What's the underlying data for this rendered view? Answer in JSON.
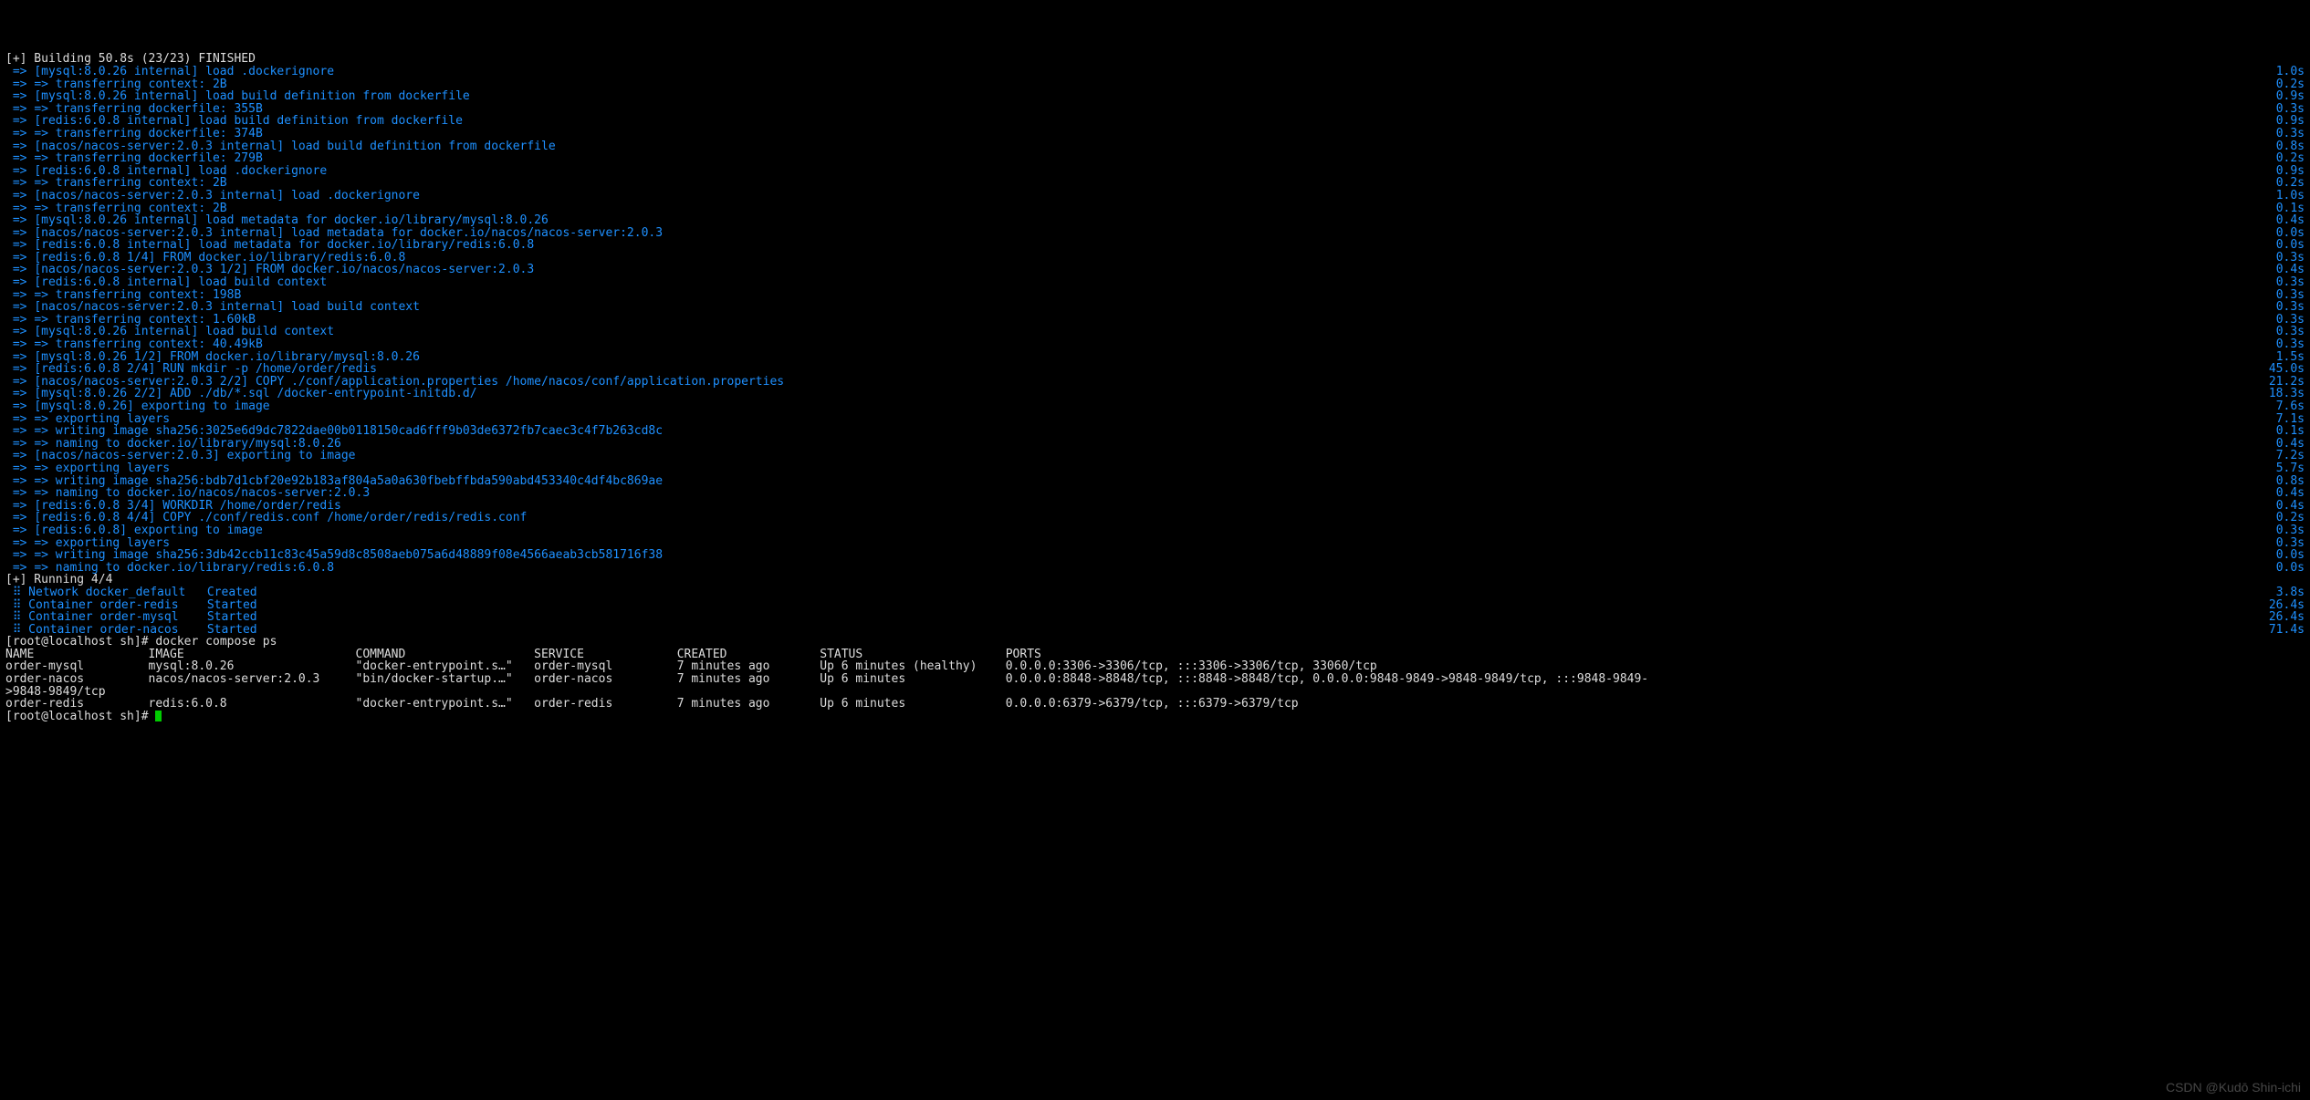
{
  "header": "[+] Building 50.8s (23/23) FINISHED",
  "lines": [
    {
      "text": "[mysql:8.0.26 internal] load .dockerignore",
      "time": "1.0s"
    },
    {
      "text": "=> transferring context: 2B",
      "time": "0.2s"
    },
    {
      "text": "[mysql:8.0.26 internal] load build definition from dockerfile",
      "time": "0.9s"
    },
    {
      "text": "=> transferring dockerfile: 355B",
      "time": "0.3s"
    },
    {
      "text": "[redis:6.0.8 internal] load build definition from dockerfile",
      "time": "0.9s"
    },
    {
      "text": "=> transferring dockerfile: 374B",
      "time": "0.3s"
    },
    {
      "text": "[nacos/nacos-server:2.0.3 internal] load build definition from dockerfile",
      "time": "0.8s"
    },
    {
      "text": "=> transferring dockerfile: 279B",
      "time": "0.2s"
    },
    {
      "text": "[redis:6.0.8 internal] load .dockerignore",
      "time": "0.9s"
    },
    {
      "text": "=> transferring context: 2B",
      "time": "0.2s"
    },
    {
      "text": "[nacos/nacos-server:2.0.3 internal] load .dockerignore",
      "time": "1.0s"
    },
    {
      "text": "=> transferring context: 2B",
      "time": "0.1s"
    },
    {
      "text": "[mysql:8.0.26 internal] load metadata for docker.io/library/mysql:8.0.26",
      "time": "0.4s"
    },
    {
      "text": "[nacos/nacos-server:2.0.3 internal] load metadata for docker.io/nacos/nacos-server:2.0.3",
      "time": "0.0s"
    },
    {
      "text": "[redis:6.0.8 internal] load metadata for docker.io/library/redis:6.0.8",
      "time": "0.0s"
    },
    {
      "text": "[redis:6.0.8 1/4] FROM docker.io/library/redis:6.0.8",
      "time": "0.3s"
    },
    {
      "text": "[nacos/nacos-server:2.0.3 1/2] FROM docker.io/nacos/nacos-server:2.0.3",
      "time": "0.4s"
    },
    {
      "text": "[redis:6.0.8 internal] load build context",
      "time": "0.3s"
    },
    {
      "text": "=> transferring context: 198B",
      "time": "0.3s"
    },
    {
      "text": "[nacos/nacos-server:2.0.3 internal] load build context",
      "time": "0.3s"
    },
    {
      "text": "=> transferring context: 1.60kB",
      "time": "0.3s"
    },
    {
      "text": "[mysql:8.0.26 internal] load build context",
      "time": "0.3s"
    },
    {
      "text": "=> transferring context: 40.49kB",
      "time": "0.3s"
    },
    {
      "text": "[mysql:8.0.26 1/2] FROM docker.io/library/mysql:8.0.26",
      "time": "1.5s"
    },
    {
      "text": "[redis:6.0.8 2/4] RUN mkdir -p /home/order/redis",
      "time": "45.0s"
    },
    {
      "text": "[nacos/nacos-server:2.0.3 2/2] COPY ./conf/application.properties /home/nacos/conf/application.properties",
      "time": "21.2s"
    },
    {
      "text": "[mysql:8.0.26 2/2] ADD ./db/*.sql /docker-entrypoint-initdb.d/",
      "time": "18.3s"
    },
    {
      "text": "[mysql:8.0.26] exporting to image",
      "time": "7.6s"
    },
    {
      "text": "=> exporting layers",
      "time": "7.1s"
    },
    {
      "text": "=> writing image sha256:3025e6d9dc7822dae00b0118150cad6fff9b03de6372fb7caec3c4f7b263cd8c",
      "time": "0.1s"
    },
    {
      "text": "=> naming to docker.io/library/mysql:8.0.26",
      "time": "0.4s"
    },
    {
      "text": "[nacos/nacos-server:2.0.3] exporting to image",
      "time": "7.2s"
    },
    {
      "text": "=> exporting layers",
      "time": "5.7s"
    },
    {
      "text": "=> writing image sha256:bdb7d1cbf20e92b183af804a5a0a630fbebffbda590abd453340c4df4bc869ae",
      "time": "0.8s"
    },
    {
      "text": "=> naming to docker.io/nacos/nacos-server:2.0.3",
      "time": "0.4s"
    },
    {
      "text": "[redis:6.0.8 3/4] WORKDIR /home/order/redis",
      "time": "0.4s"
    },
    {
      "text": "[redis:6.0.8 4/4] COPY ./conf/redis.conf /home/order/redis/redis.conf",
      "time": "0.2s"
    },
    {
      "text": "[redis:6.0.8] exporting to image",
      "time": "0.3s"
    },
    {
      "text": "=> exporting layers",
      "time": "0.3s"
    },
    {
      "text": "=> writing image sha256:3db42ccb11c83c45a59d8c8508aeb075a6d48889f08e4566aeab3cb581716f38",
      "time": "0.0s"
    },
    {
      "text": "=> naming to docker.io/library/redis:6.0.8",
      "time": "0.0s"
    }
  ],
  "running_header": "[+] Running 4/4",
  "running": [
    {
      "label": "Network docker_default   Created",
      "time": "3.8s"
    },
    {
      "label": "Container order-redis    Started",
      "time": "26.4s"
    },
    {
      "label": "Container order-mysql    Started",
      "time": "26.4s"
    },
    {
      "label": "Container order-nacos    Started",
      "time": "71.4s"
    }
  ],
  "prompt1": "[root@localhost sh]# ",
  "cmd1": "docker compose ps",
  "ps": {
    "header": "NAME                IMAGE                        COMMAND                  SERVICE             CREATED             STATUS                    PORTS",
    "rows": [
      "order-mysql         mysql:8.0.26                 \"docker-entrypoint.s…\"   order-mysql         7 minutes ago       Up 6 minutes (healthy)    0.0.0.0:3306->3306/tcp, :::3306->3306/tcp, 33060/tcp",
      "order-nacos         nacos/nacos-server:2.0.3     \"bin/docker-startup.…\"   order-nacos         7 minutes ago       Up 6 minutes              0.0.0.0:8848->8848/tcp, :::8848->8848/tcp, 0.0.0.0:9848-9849->9848-9849/tcp, :::9848-9849-",
      ">9848-9849/tcp",
      "order-redis         redis:6.0.8                  \"docker-entrypoint.s…\"   order-redis         7 minutes ago       Up 6 minutes              0.0.0.0:6379->6379/tcp, :::6379->6379/tcp"
    ]
  },
  "prompt2": "[root@localhost sh]# ",
  "watermark": "CSDN @Kudō Shin-ichi"
}
